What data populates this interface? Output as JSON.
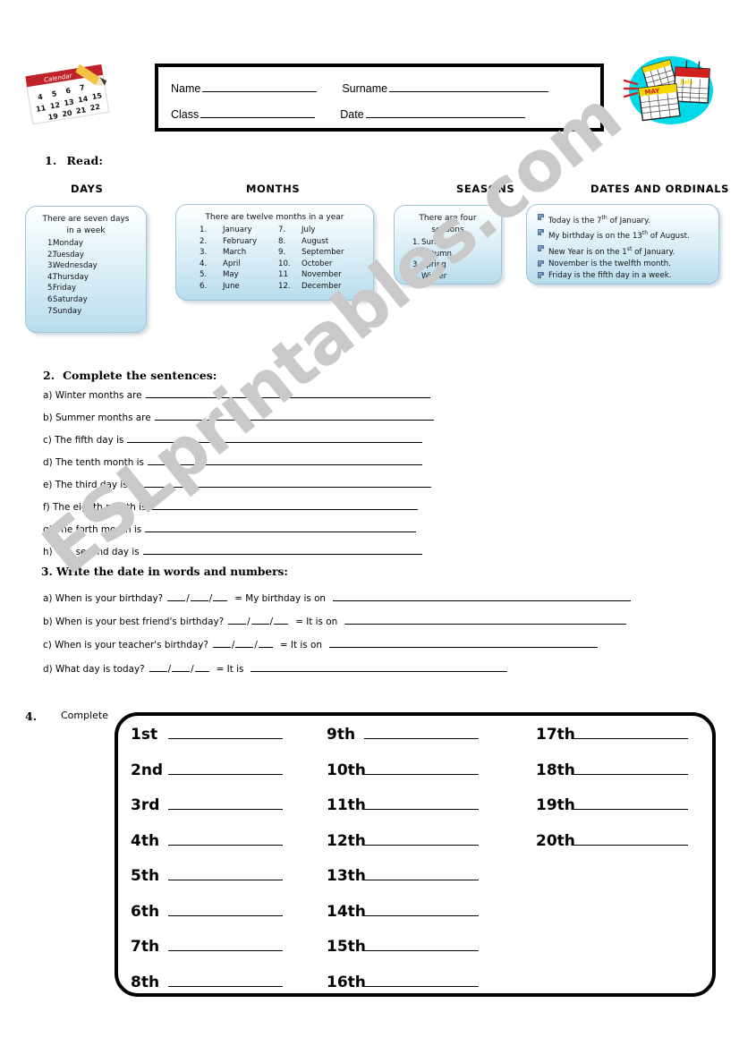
{
  "watermark": {
    "text": "ESLprintables.com"
  },
  "header": {
    "left_art": "calendar-pencil-clipart",
    "right_art": "calendars-oval-clipart",
    "fields": {
      "name_label": "Name",
      "surname_label": "Surname",
      "class_label": "Class",
      "date_label": "Date"
    }
  },
  "task1": {
    "number": "1.",
    "title": "Read:",
    "columns": [
      {
        "heading": "DAYS"
      },
      {
        "heading": "MONTHS"
      },
      {
        "heading": "SEASONS"
      },
      {
        "heading": "DATES AND ORDINALS"
      }
    ],
    "days_box": {
      "intro_line1": "There are seven days",
      "intro_line2": "in a week",
      "items": [
        {
          "idx": "1.",
          "name": "Monday"
        },
        {
          "idx": "2.",
          "name": "Tuesday"
        },
        {
          "idx": "3.",
          "name": "Wednesday"
        },
        {
          "idx": "4.",
          "name": "Thursday"
        },
        {
          "idx": "5.",
          "name": "Friday"
        },
        {
          "idx": "6.",
          "name": "Saturday"
        },
        {
          "idx": "7.",
          "name": "Sunday"
        }
      ]
    },
    "months_box": {
      "intro": "There  are  twelve  months  in  a year",
      "left": [
        {
          "idx": "1.",
          "name": "January"
        },
        {
          "idx": "2.",
          "name": "February"
        },
        {
          "idx": "3.",
          "name": "March"
        },
        {
          "idx": "4.",
          "name": "April"
        },
        {
          "idx": "5.",
          "name": "May"
        },
        {
          "idx": "6.",
          "name": "June"
        }
      ],
      "right": [
        {
          "idx": "7.",
          "name": "July"
        },
        {
          "idx": "8.",
          "name": "August"
        },
        {
          "idx": "9.",
          "name": "September"
        },
        {
          "idx": "10.",
          "name": "October"
        },
        {
          "idx": "11",
          "name": "November"
        },
        {
          "idx": "12.",
          "name": "December"
        }
      ]
    },
    "seasons_box": {
      "intro_line1": "There are four",
      "intro_line2": "seasons",
      "items": [
        {
          "idx": "1.",
          "name": "Summer"
        },
        {
          "idx": "2.",
          "name": "Autumn"
        },
        {
          "idx": "3.",
          "name": "Spring"
        },
        {
          "idx": "4.",
          "name": "Winter"
        }
      ]
    },
    "dates_box": {
      "items": [
        {
          "pre": "Today is the 7",
          "sup": "th",
          "post": " of January."
        },
        {
          "pre": "My birthday is on the 13",
          "sup": "th",
          "post": " of August."
        },
        {
          "pre": "New Year is on the 1",
          "sup": "st",
          "post": " of January."
        },
        {
          "pre": "November is the twelfth month.",
          "sup": "",
          "post": ""
        },
        {
          "pre": "Friday is the fifth day in a week.",
          "sup": "",
          "post": ""
        }
      ]
    }
  },
  "task2": {
    "number": "2.",
    "title": "Complete the sentences:",
    "questions": [
      {
        "label": "a)",
        "text": "Winter months are"
      },
      {
        "label": "b)",
        "text": "Summer months are"
      },
      {
        "label": "c)",
        "text": "The fifth day is"
      },
      {
        "label": "d)",
        "text": "The tenth month is"
      },
      {
        "label": "e)",
        "text": "The third day is"
      },
      {
        "label": "f)",
        "text": "The eighth month is"
      },
      {
        "label": "g)",
        "text": "The forth month is"
      },
      {
        "label": "h)",
        "text": "The second day is"
      }
    ]
  },
  "task3": {
    "title": "3. Write the date in words and numbers:",
    "questions": [
      {
        "label": "a)",
        "question": "When is your birthday?",
        "equals": "=",
        "answer_lead": "My birthday is on"
      },
      {
        "label": "b)",
        "question": "When is your best friend's birthday?",
        "equals": "=",
        "answer_lead": "It is on"
      },
      {
        "label": "c)",
        "question": "When is your teacher's birthday?",
        "equals": "=",
        "answer_lead": "It is on"
      },
      {
        "label": "d)",
        "question": "What day is today?",
        "equals": "=",
        "answer_lead": "It is"
      }
    ]
  },
  "task4": {
    "number": "4.",
    "title": "Complete",
    "column1": [
      "1st",
      "2nd",
      "3rd",
      "4th",
      "5th",
      "6th",
      "7th",
      "8th"
    ],
    "column2": [
      "9th",
      "10th",
      "11th",
      "12th",
      "13th",
      "14th",
      "15th",
      "16th"
    ],
    "column3": [
      "17th",
      "18th",
      "19th",
      "20th"
    ]
  }
}
